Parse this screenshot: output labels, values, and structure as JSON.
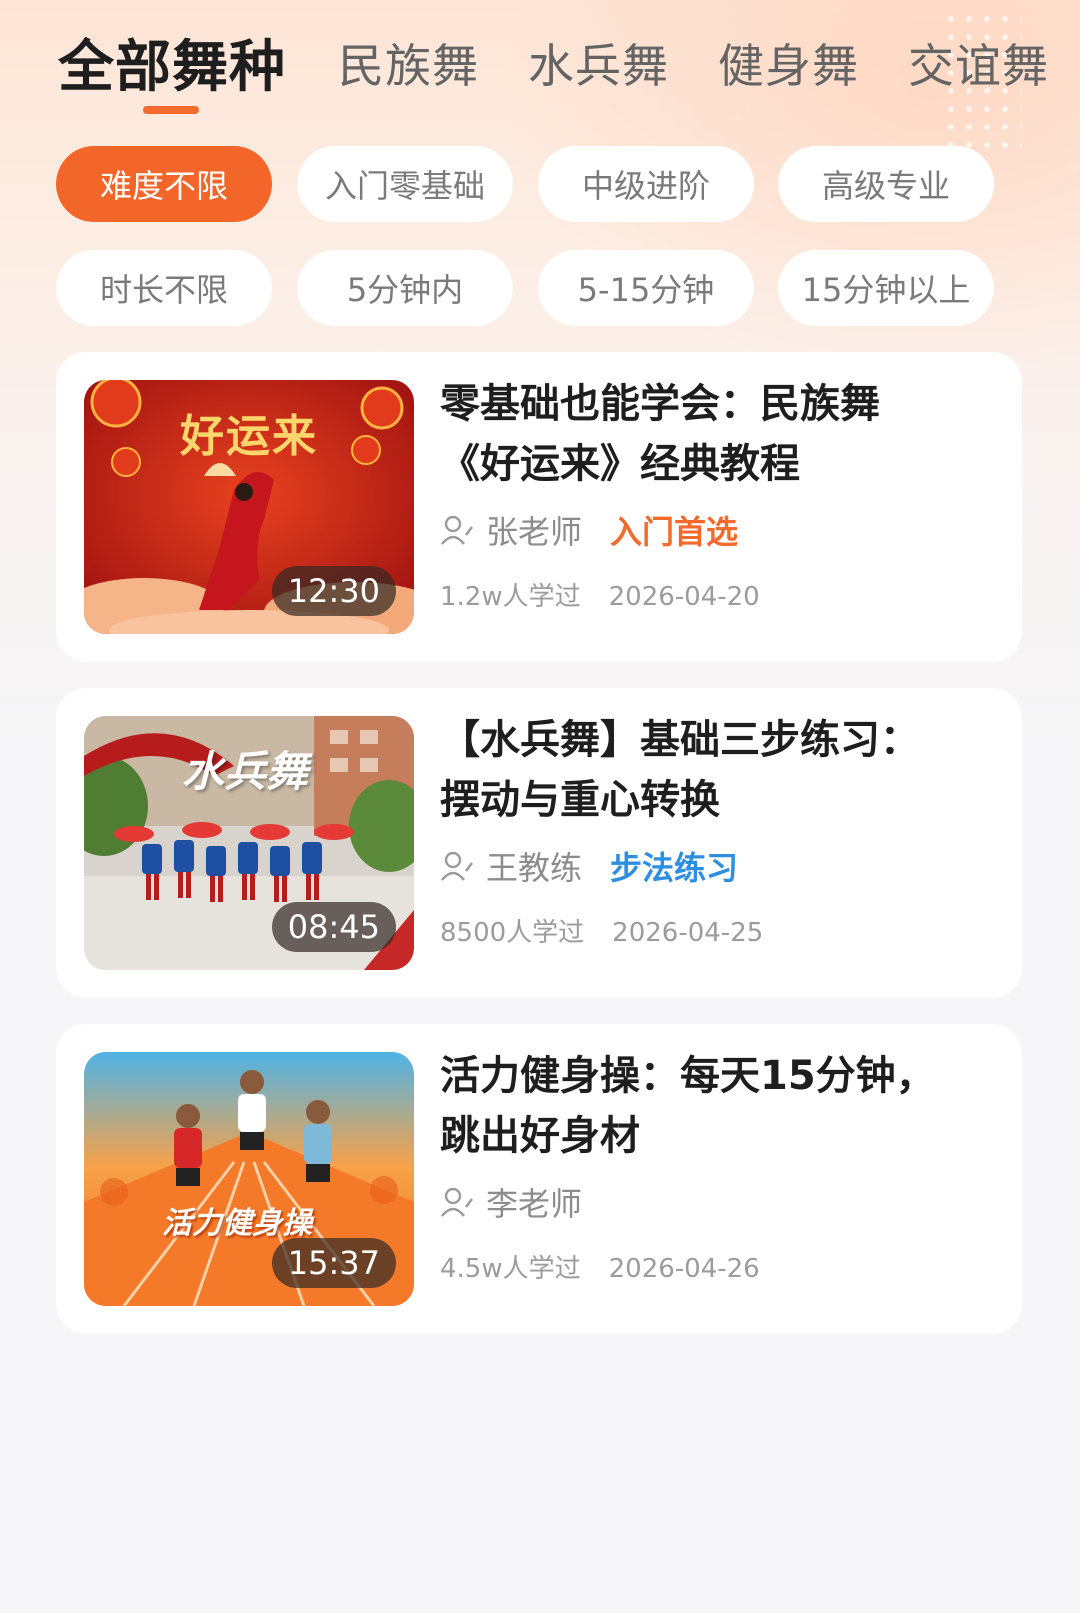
{
  "tabs": [
    {
      "label": "全部舞种",
      "active": true
    },
    {
      "label": "民族舞",
      "active": false
    },
    {
      "label": "水兵舞",
      "active": false
    },
    {
      "label": "健身舞",
      "active": false
    },
    {
      "label": "交谊舞",
      "active": false
    }
  ],
  "difficulty_filters": [
    {
      "label": "难度不限",
      "active": true
    },
    {
      "label": "入门零基础",
      "active": false
    },
    {
      "label": "中级进阶",
      "active": false
    },
    {
      "label": "高级专业",
      "active": false
    }
  ],
  "duration_filters": [
    {
      "label": "时长不限",
      "active": false
    },
    {
      "label": "5分钟内",
      "active": false
    },
    {
      "label": "5-15分钟",
      "active": false
    },
    {
      "label": "15分钟以上",
      "active": false
    }
  ],
  "courses": [
    {
      "title_line1": "零基础也能学会：民族舞",
      "title_line2": "《好运来》经典教程",
      "thumb_text": "好运来",
      "duration": "12:30",
      "teacher": "张老师",
      "tag": "入门首选",
      "tag_color": "#f36a2c",
      "learners": "1.2w人学过",
      "date": "2026-04-20"
    },
    {
      "title_line1": "【水兵舞】基础三步练习：",
      "title_line2": "摆动与重心转换",
      "thumb_text": "水兵舞",
      "duration": "08:45",
      "teacher": "王教练",
      "tag": "步法练习",
      "tag_color": "#2d8fe0",
      "learners": "8500人学过",
      "date": "2026-04-25"
    },
    {
      "title_line1": "活力健身操：每天15分钟，",
      "title_line2": "跳出好身材",
      "thumb_text": "活力健身操",
      "duration": "15:37",
      "teacher": "李老师",
      "tag": "",
      "tag_color": "#f36a2c",
      "learners": "4.5w人学过",
      "date": "2026-04-26"
    }
  ],
  "icons": {
    "person": "person-icon",
    "tab_indicator": "tab-indicator"
  },
  "colors": {
    "accent": "#f2662a",
    "tag_blue": "#2d8fe0"
  }
}
